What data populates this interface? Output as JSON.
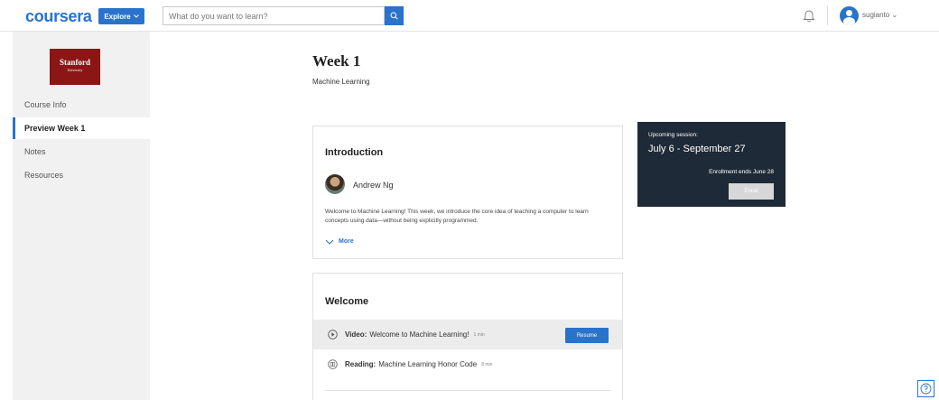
{
  "header": {
    "logo": "coursera",
    "explore_label": "Explore",
    "search_placeholder": "What do you want to learn?",
    "user_name": "sugianto"
  },
  "sidebar": {
    "logo_line1": "Stanford",
    "logo_line2": "University",
    "items": [
      {
        "label": "Course Info"
      },
      {
        "label": "Preview Week 1"
      },
      {
        "label": "Notes"
      },
      {
        "label": "Resources"
      }
    ]
  },
  "main": {
    "week_title": "Week 1",
    "course_name": "Machine Learning",
    "intro": {
      "title": "Introduction",
      "instructor": "Andrew Ng",
      "text": "Welcome to Machine Learning! This week, we introduce the core idea of teaching a computer to learn concepts using data—without being explicitly programmed.",
      "more_label": "More"
    },
    "welcome": {
      "title": "Welcome",
      "items": [
        {
          "type_label": "Video:",
          "title": "Welcome to Machine Learning!",
          "duration": "1 min",
          "action": "Resume"
        },
        {
          "type_label": "Reading:",
          "title": "Machine Learning Honor Code",
          "duration": "8 min"
        }
      ]
    }
  },
  "session": {
    "label": "Upcoming session:",
    "dates": "July 6 - September 27",
    "enrollment_ends": "Enrollment ends June 28",
    "enroll_label": "Enroll"
  },
  "colors": {
    "accent": "#2a73cc",
    "stanford_red": "#8c1515",
    "session_bg": "#1f2a38"
  }
}
